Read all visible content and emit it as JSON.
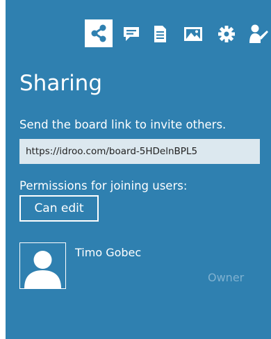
{
  "toolbar": {
    "icons": [
      "share-icon",
      "chat-icon",
      "document-icon",
      "image-icon",
      "gear-icon",
      "user-icon"
    ],
    "active_icon": "share-icon",
    "icon_color": "#ffffff",
    "active_icon_color": "#2f80b0"
  },
  "sharing": {
    "title": "Sharing",
    "instruction": "Send the board link to invite others.",
    "link_value": "https://idroo.com/board-5HDelnBPL5",
    "permissions_label": "Permissions for joining users:",
    "permission_value": "Can edit"
  },
  "users": [
    {
      "name": "Timo Gobec",
      "role": "Owner"
    }
  ],
  "colors": {
    "panel_background": "#2f80b0",
    "input_background": "#dce8ef",
    "muted_text": "#7fb1d0",
    "text": "#ffffff"
  }
}
